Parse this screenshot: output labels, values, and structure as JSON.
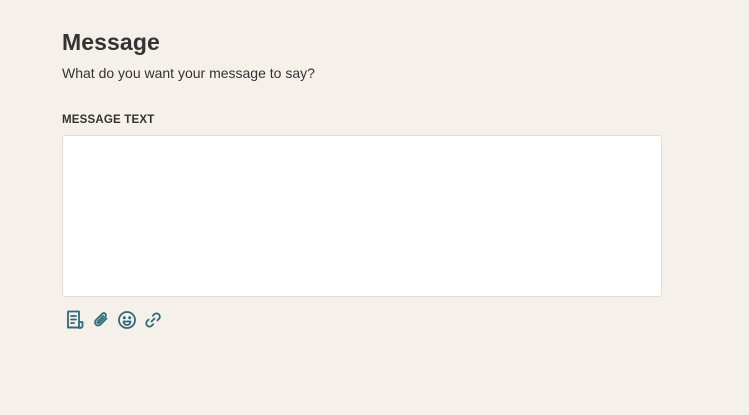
{
  "header": {
    "title": "Message",
    "subtitle": "What do you want your message to say?"
  },
  "message_field": {
    "label": "MESSAGE TEXT",
    "value": "",
    "placeholder": ""
  },
  "toolbar": {
    "icons": [
      "template-icon",
      "paperclip-icon",
      "emoji-icon",
      "link-icon"
    ]
  },
  "colors": {
    "background": "#f5f0ea",
    "icon": "#2f6a7a",
    "text": "#333333",
    "textarea_border": "#e2ddd7"
  }
}
